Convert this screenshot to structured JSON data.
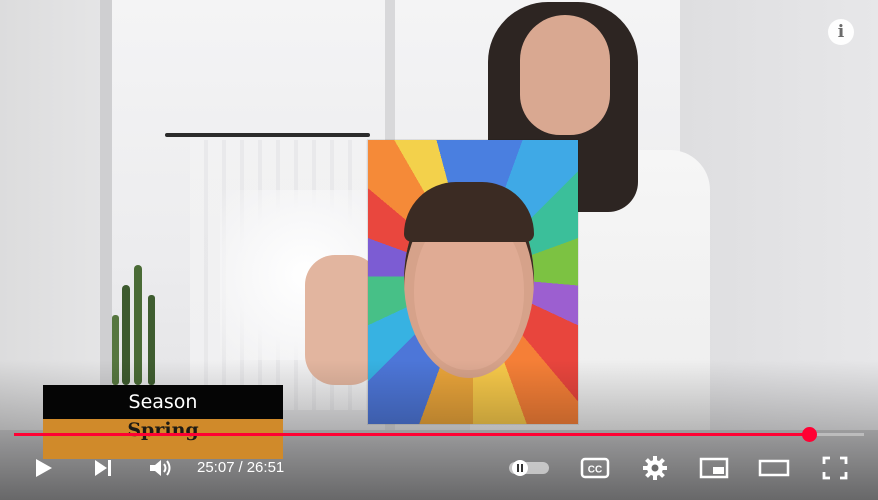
{
  "caption": {
    "title": "Season",
    "value": "Spring"
  },
  "playback": {
    "current_time": "25:07",
    "separator": "/",
    "duration": "26:51",
    "progress_fraction": 0.9355
  },
  "icons": {
    "info": "info-icon",
    "play": "play-icon",
    "next": "next-icon",
    "volume": "volume-icon",
    "autoplay": "autoplay-toggle-icon",
    "captions": "cc-icon",
    "settings": "gear-icon",
    "miniplayer": "miniplayer-icon",
    "theater": "theater-mode-icon",
    "fullscreen": "fullscreen-icon"
  },
  "labels": {
    "info_glyph": "i",
    "cc_label": "CC"
  },
  "colors": {
    "progress": "#ff0033",
    "caption_title_bg": "#050505",
    "caption_value_bg": "#d08a2a"
  }
}
